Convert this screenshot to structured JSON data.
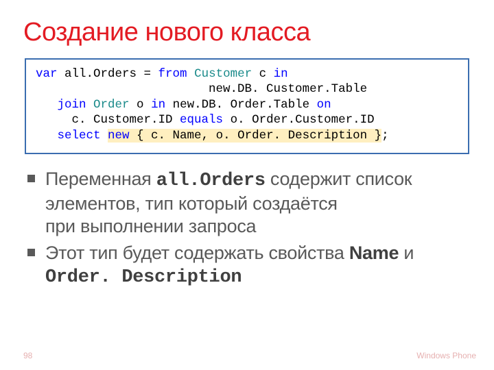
{
  "title": "Создание нового класса",
  "code": {
    "l1a": "var",
    "l1b": " all.Orders = ",
    "l1c": "from ",
    "l1d": "Customer",
    "l1e": " c ",
    "l1f": "in",
    "l2a": "                        new.DB. Customer.Table",
    "l3a": "   ",
    "l3b": "join ",
    "l3c": "Order",
    "l3d": " o ",
    "l3e": "in",
    "l3f": " new.DB. Order.Table ",
    "l3g": "on",
    "l4a": "     c. Customer.ID ",
    "l4b": "equals",
    "l4c": " o. Order.Customer.ID",
    "l5a": "   ",
    "l5b": "select ",
    "l5c": "new",
    "l5d": " { c. Name, o. Order. Description }",
    "l5e": ";"
  },
  "bullets": [
    {
      "pre": "Переменная ",
      "mono": "all.Orders",
      "post": " содержит список элементов, тип который создаётся при выполнении запроса"
    },
    {
      "pre": "Этот тип будет содержать свойства ",
      "bold1": "Name",
      "mid": " и ",
      "mono2": "Order. Description"
    }
  ],
  "footer": {
    "page": "98",
    "brand": "Windows Phone"
  }
}
